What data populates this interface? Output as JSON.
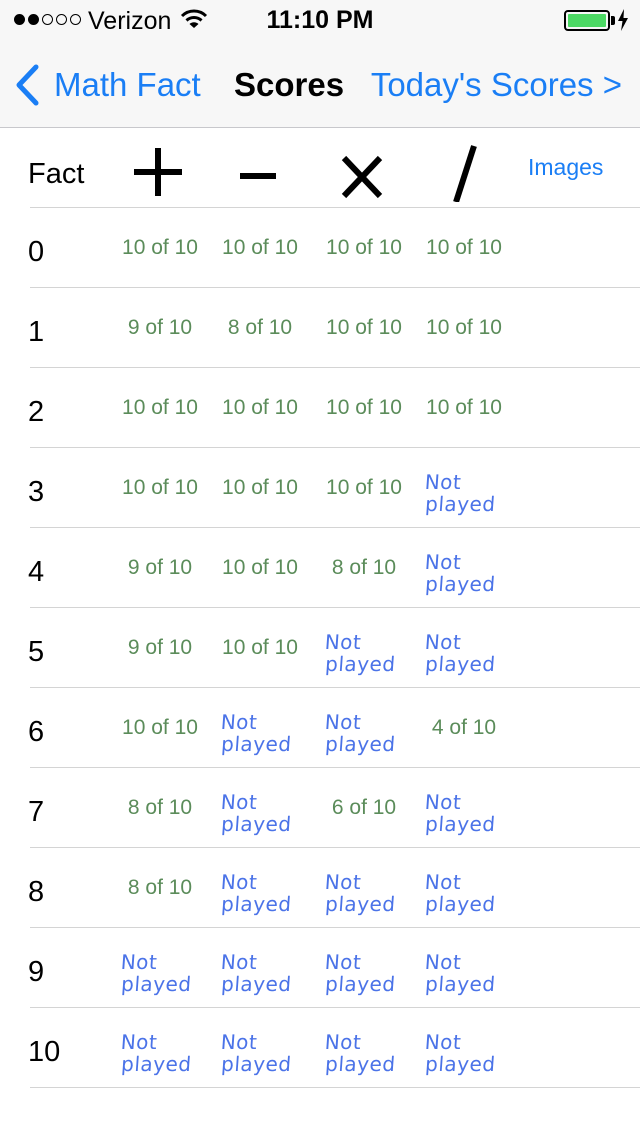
{
  "status_bar": {
    "signal_dots": [
      true,
      true,
      false,
      false,
      false
    ],
    "carrier": "Verizon",
    "time": "11:10 PM",
    "battery_level": 1.0,
    "wifi_icon": "wifi-icon",
    "charging_icon": "bolt-icon"
  },
  "nav": {
    "back_label": "Math Fact",
    "title": "Scores",
    "right_label": "Today's Scores >"
  },
  "header": {
    "fact_label": "Fact",
    "operators": [
      "plus",
      "minus",
      "times",
      "divide"
    ],
    "images_label": "Images"
  },
  "colors": {
    "accent": "#1a7ef5",
    "score": "#5b8c5a",
    "not_played": "#4b73e8",
    "battery": "#4cd964"
  },
  "not_played_text": "Not played",
  "rows": [
    {
      "fact": "0",
      "plus": "10 of 10",
      "minus": "10 of 10",
      "times": "10 of 10",
      "divide": "10 of 10"
    },
    {
      "fact": "1",
      "plus": "9 of 10",
      "minus": "8 of 10",
      "times": "10 of 10",
      "divide": "10 of 10"
    },
    {
      "fact": "2",
      "plus": "10 of 10",
      "minus": "10 of 10",
      "times": "10 of 10",
      "divide": "10 of 10"
    },
    {
      "fact": "3",
      "plus": "10 of 10",
      "minus": "10 of 10",
      "times": "10 of 10",
      "divide": "Not played"
    },
    {
      "fact": "4",
      "plus": "9 of 10",
      "minus": "10 of 10",
      "times": "8 of 10",
      "divide": "Not played"
    },
    {
      "fact": "5",
      "plus": "9 of 10",
      "minus": "10 of 10",
      "times": "Not played",
      "divide": "Not played"
    },
    {
      "fact": "6",
      "plus": "10 of 10",
      "minus": "Not played",
      "times": "Not played",
      "divide": "4 of 10"
    },
    {
      "fact": "7",
      "plus": "8 of 10",
      "minus": "Not played",
      "times": "6 of 10",
      "divide": "Not played"
    },
    {
      "fact": "8",
      "plus": "8 of 10",
      "minus": "Not played",
      "times": "Not played",
      "divide": "Not played"
    },
    {
      "fact": "9",
      "plus": "Not played",
      "minus": "Not played",
      "times": "Not played",
      "divide": "Not played"
    },
    {
      "fact": "10",
      "plus": "Not played",
      "minus": "Not played",
      "times": "Not played",
      "divide": "Not played"
    }
  ]
}
